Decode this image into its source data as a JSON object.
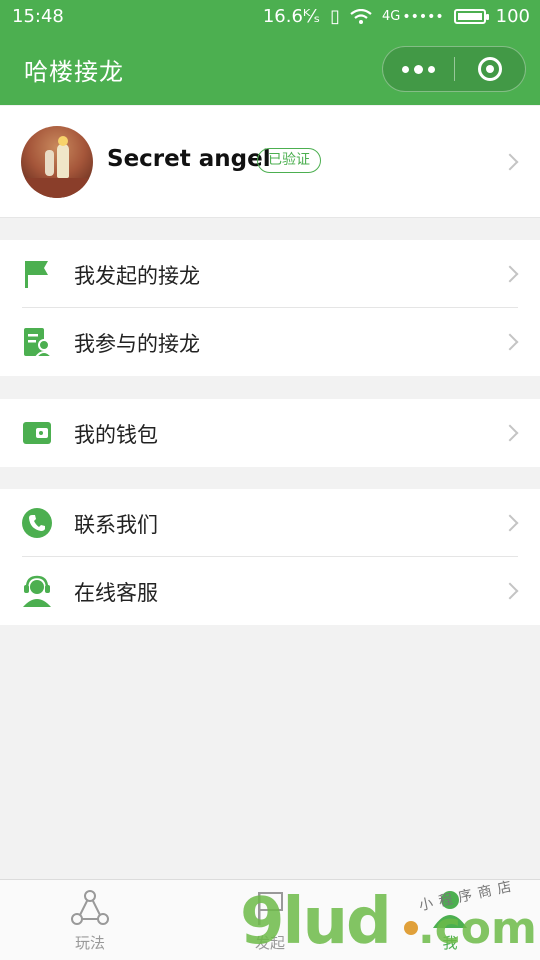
{
  "status_bar": {
    "time": "15:48",
    "speed": "16.6ᴷ⁄ₛ",
    "network": "4G",
    "carrier_dots": "•••••",
    "battery": "100"
  },
  "nav": {
    "title": "哈楼接龙",
    "more_icon": "more-dots-icon",
    "close_icon": "target-close-icon"
  },
  "profile": {
    "name": "Secret angel",
    "badge": "已验证"
  },
  "menu_groups": [
    {
      "items": [
        {
          "label": "我发起的接龙",
          "icon": "flag-icon"
        },
        {
          "label": "我参与的接龙",
          "icon": "document-user-icon"
        }
      ]
    },
    {
      "items": [
        {
          "label": "我的钱包",
          "icon": "wallet-icon"
        }
      ]
    },
    {
      "items": [
        {
          "label": "联系我们",
          "icon": "phone-icon"
        },
        {
          "label": "在线客服",
          "icon": "headset-icon"
        }
      ]
    }
  ],
  "tabbar": {
    "tabs": [
      {
        "label": "玩法",
        "icon": "share-icon"
      },
      {
        "label": "发起",
        "icon": "flag-icon"
      },
      {
        "label": "我",
        "icon": "user-icon"
      }
    ],
    "active_index": 2
  },
  "watermark": {
    "text": "9lud",
    "domain": ".com",
    "subtitle": "小程序商店"
  },
  "colors": {
    "accent": "#4caf50",
    "background": "#f2f2f2"
  }
}
